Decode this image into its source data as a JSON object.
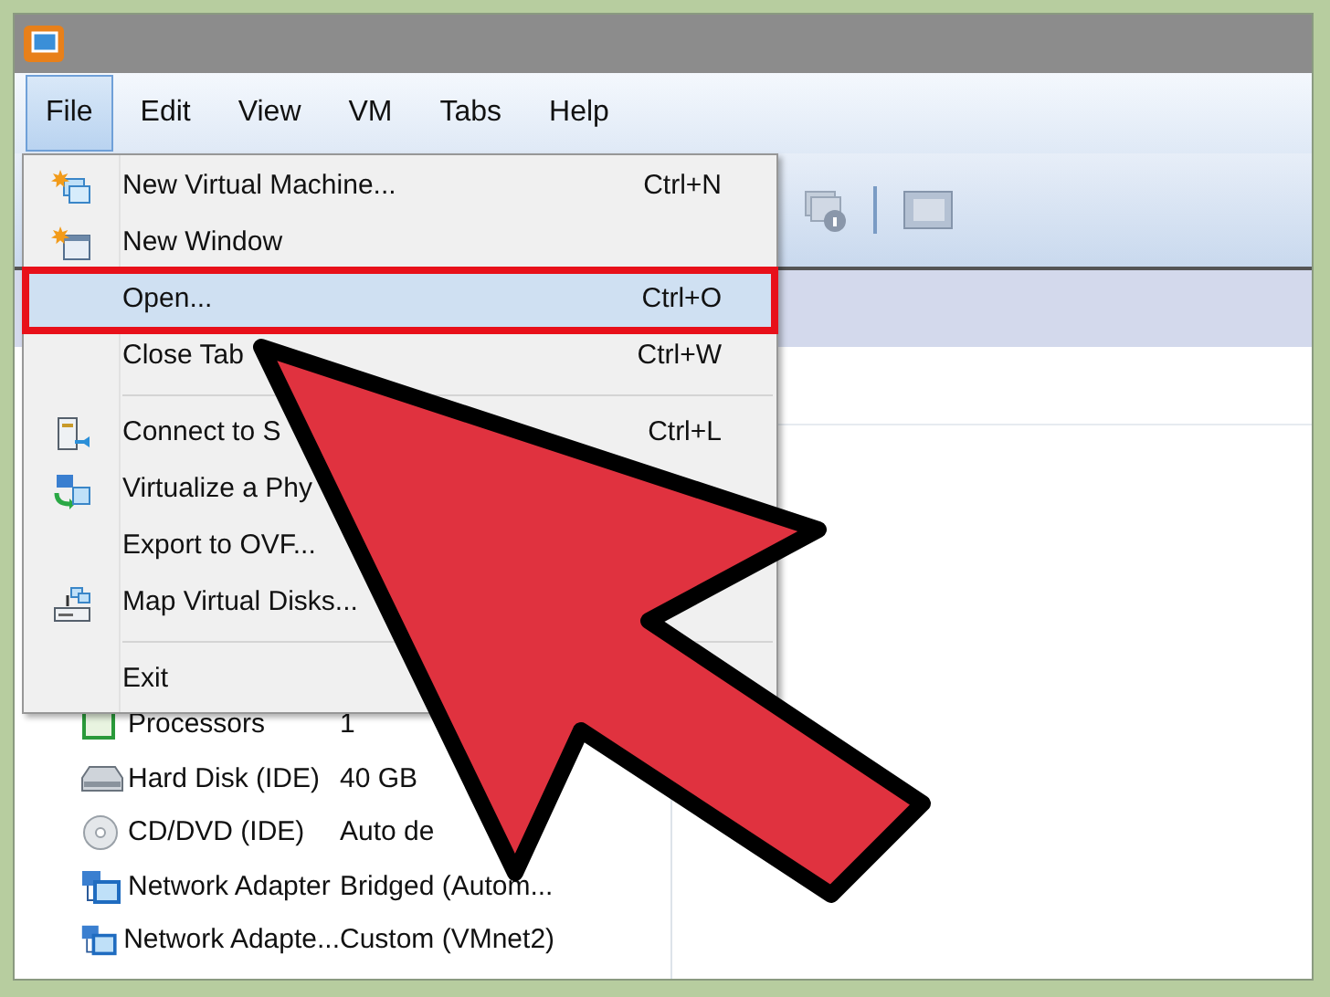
{
  "menu_bar": [
    {
      "label": "File",
      "selected": true
    },
    {
      "label": "Edit",
      "selected": false
    },
    {
      "label": "View",
      "selected": false
    },
    {
      "label": "VM",
      "selected": false
    },
    {
      "label": "Tabs",
      "selected": false
    },
    {
      "label": "Help",
      "selected": false
    }
  ],
  "file_menu": [
    {
      "kind": "item",
      "label": "New Virtual Machine...",
      "shortcut": "Ctrl+N",
      "selected": false,
      "outlined": false
    },
    {
      "kind": "item",
      "label": "New Window",
      "selected": false,
      "outlined": false
    },
    {
      "kind": "item",
      "label": "Open...",
      "shortcut": "Ctrl+O",
      "selected": true,
      "outlined": true
    },
    {
      "kind": "item",
      "label": "Close Tab",
      "shortcut": "Ctrl+W",
      "selected": false,
      "outlined": false
    },
    {
      "kind": "separator"
    },
    {
      "kind": "item",
      "label": "Connect to S",
      "shortcut": "Ctrl+L",
      "selected": false,
      "outlined": false
    },
    {
      "kind": "item",
      "label": "Virtualize a Phy",
      "selected": false,
      "outlined": false
    },
    {
      "kind": "item",
      "label": "Export to OVF...",
      "selected": false,
      "outlined": false
    },
    {
      "kind": "item",
      "label": "Map Virtual Disks...",
      "selected": false,
      "outlined": false
    },
    {
      "kind": "separator"
    },
    {
      "kind": "item",
      "label": "Exit",
      "selected": false,
      "outlined": false
    }
  ],
  "devices": [
    {
      "name": "Processors",
      "value": "1"
    },
    {
      "name": "Hard Disk (IDE)",
      "value": "40 GB"
    },
    {
      "name": "CD/DVD (IDE)",
      "value": "Auto de"
    },
    {
      "name": "Network Adapter",
      "value": "Bridged (Autom..."
    },
    {
      "name": "Network Adapte...",
      "value": "Custom (VMnet2)"
    }
  ],
  "annotation": {
    "kind": "arrow"
  }
}
